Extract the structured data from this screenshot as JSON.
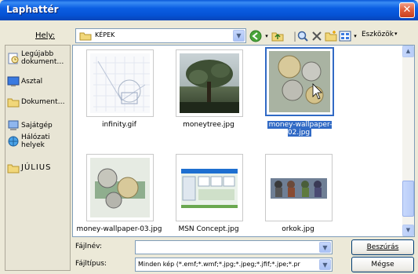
{
  "window": {
    "title": "Laphattér",
    "close_label": "✕"
  },
  "toolbar": {
    "location_label": "Hely:",
    "location_value": "KÉPEK",
    "tools_label": "Eszközök"
  },
  "places": [
    {
      "label": "Legújabb dokument…",
      "icon": "recent-docs-icon"
    },
    {
      "label": "Asztal",
      "icon": "desktop-icon"
    },
    {
      "label": "Dokument…",
      "icon": "my-documents-icon"
    },
    {
      "label": "Sajátgép",
      "icon": "my-computer-icon"
    },
    {
      "label": "Hálózati helyek",
      "icon": "network-places-icon"
    },
    {
      "label": "JÚLIUS",
      "icon": "folder-icon"
    }
  ],
  "files": [
    {
      "name": "infinity.gif",
      "selected": false
    },
    {
      "name": "moneytree.jpg",
      "selected": false
    },
    {
      "name": "money-wallpaper-02.jpg",
      "selected": true
    },
    {
      "name": "money-wallpaper-03.jpg",
      "selected": false
    },
    {
      "name": "MSN Concept.jpg",
      "selected": false
    },
    {
      "name": "orkok.jpg",
      "selected": false
    }
  ],
  "footer": {
    "filename_label": "Fájlnév:",
    "filename_value": "",
    "filetype_label": "Fájltípus:",
    "filetype_value": "Minden kép (*.emf;*.wmf;*.jpg;*.jpeg;*.jfif;*.jpe;*.pr",
    "insert_label": "Beszúrás",
    "cancel_label": "Mégse"
  },
  "colors": {
    "titlebar": "#0b5fe3",
    "selection": "#316ac5",
    "window_bg": "#ece9d8"
  }
}
